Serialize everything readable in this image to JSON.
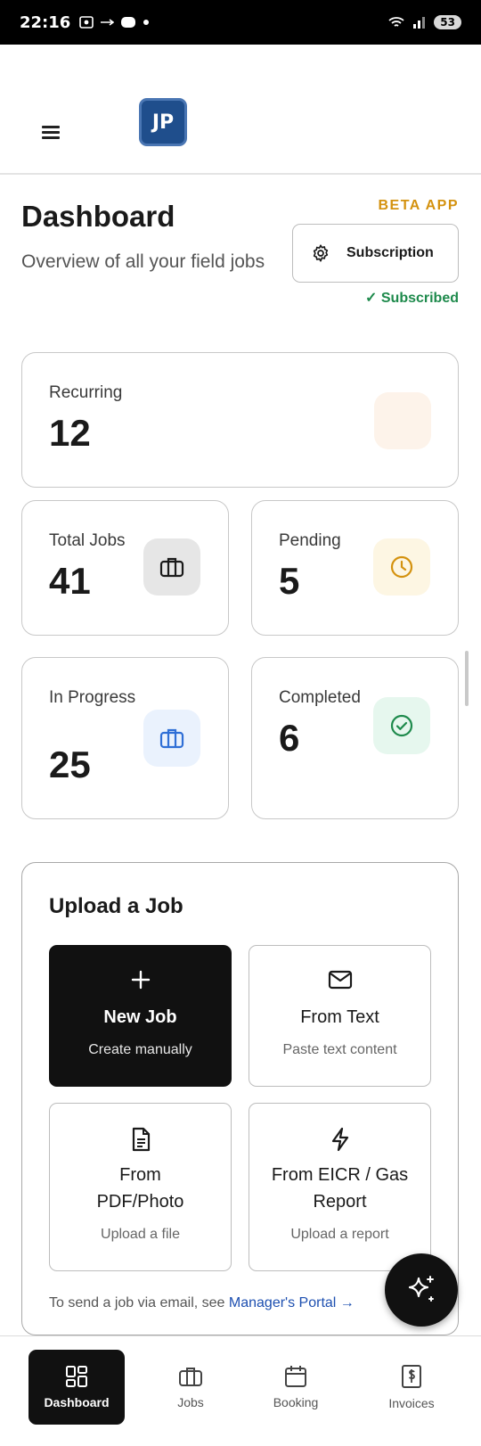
{
  "status_bar": {
    "time": "22:16",
    "battery": "53"
  },
  "header": {
    "logo_text": "JP"
  },
  "dashboard": {
    "title": "Dashboard",
    "subtitle": "Overview of all your field jobs",
    "beta_label": "BETA APP",
    "subscription_button": "Subscription",
    "subscription_status": "✓ Subscribed"
  },
  "stats": {
    "recurring": {
      "label": "Recurring",
      "value": "12"
    },
    "total_jobs": {
      "label": "Total Jobs",
      "value": "41"
    },
    "pending": {
      "label": "Pending",
      "value": "5"
    },
    "in_progress": {
      "label": "In Progress",
      "value": "25"
    },
    "completed": {
      "label": "Completed",
      "value": "6"
    }
  },
  "upload": {
    "title": "Upload a Job",
    "tiles": [
      {
        "name": "New Job",
        "sub": "Create manually",
        "icon": "plus-icon"
      },
      {
        "name": "From Text",
        "sub": "Paste text content",
        "icon": "mail-icon"
      },
      {
        "name": "From PDF/Photo",
        "sub": "Upload a file",
        "icon": "document-icon"
      },
      {
        "name": "From EICR / Gas Report",
        "sub": "Upload a report",
        "icon": "lightning-icon"
      }
    ],
    "email_note": "To send a job via email, see",
    "portal_link": "Manager's Portal →"
  },
  "bottom_nav": [
    {
      "label": "Dashboard",
      "icon": "grid-icon",
      "active": true
    },
    {
      "label": "Jobs",
      "icon": "briefcase-icon",
      "active": false
    },
    {
      "label": "Booking",
      "icon": "calendar-icon",
      "active": false
    },
    {
      "label": "Invoices",
      "icon": "dollar-doc-icon",
      "active": false
    }
  ],
  "colors": {
    "beta": "#d4920f",
    "subscribed": "#1e8a4c",
    "link": "#1d4fb0",
    "pending_icon_bg": "#fdf6e3",
    "progress_icon_bg": "#eaf2fd",
    "completed_icon_bg": "#e6f7ee",
    "total_icon_bg": "#e6e6e6",
    "recurring_icon_bg": "#fdf3ea"
  }
}
